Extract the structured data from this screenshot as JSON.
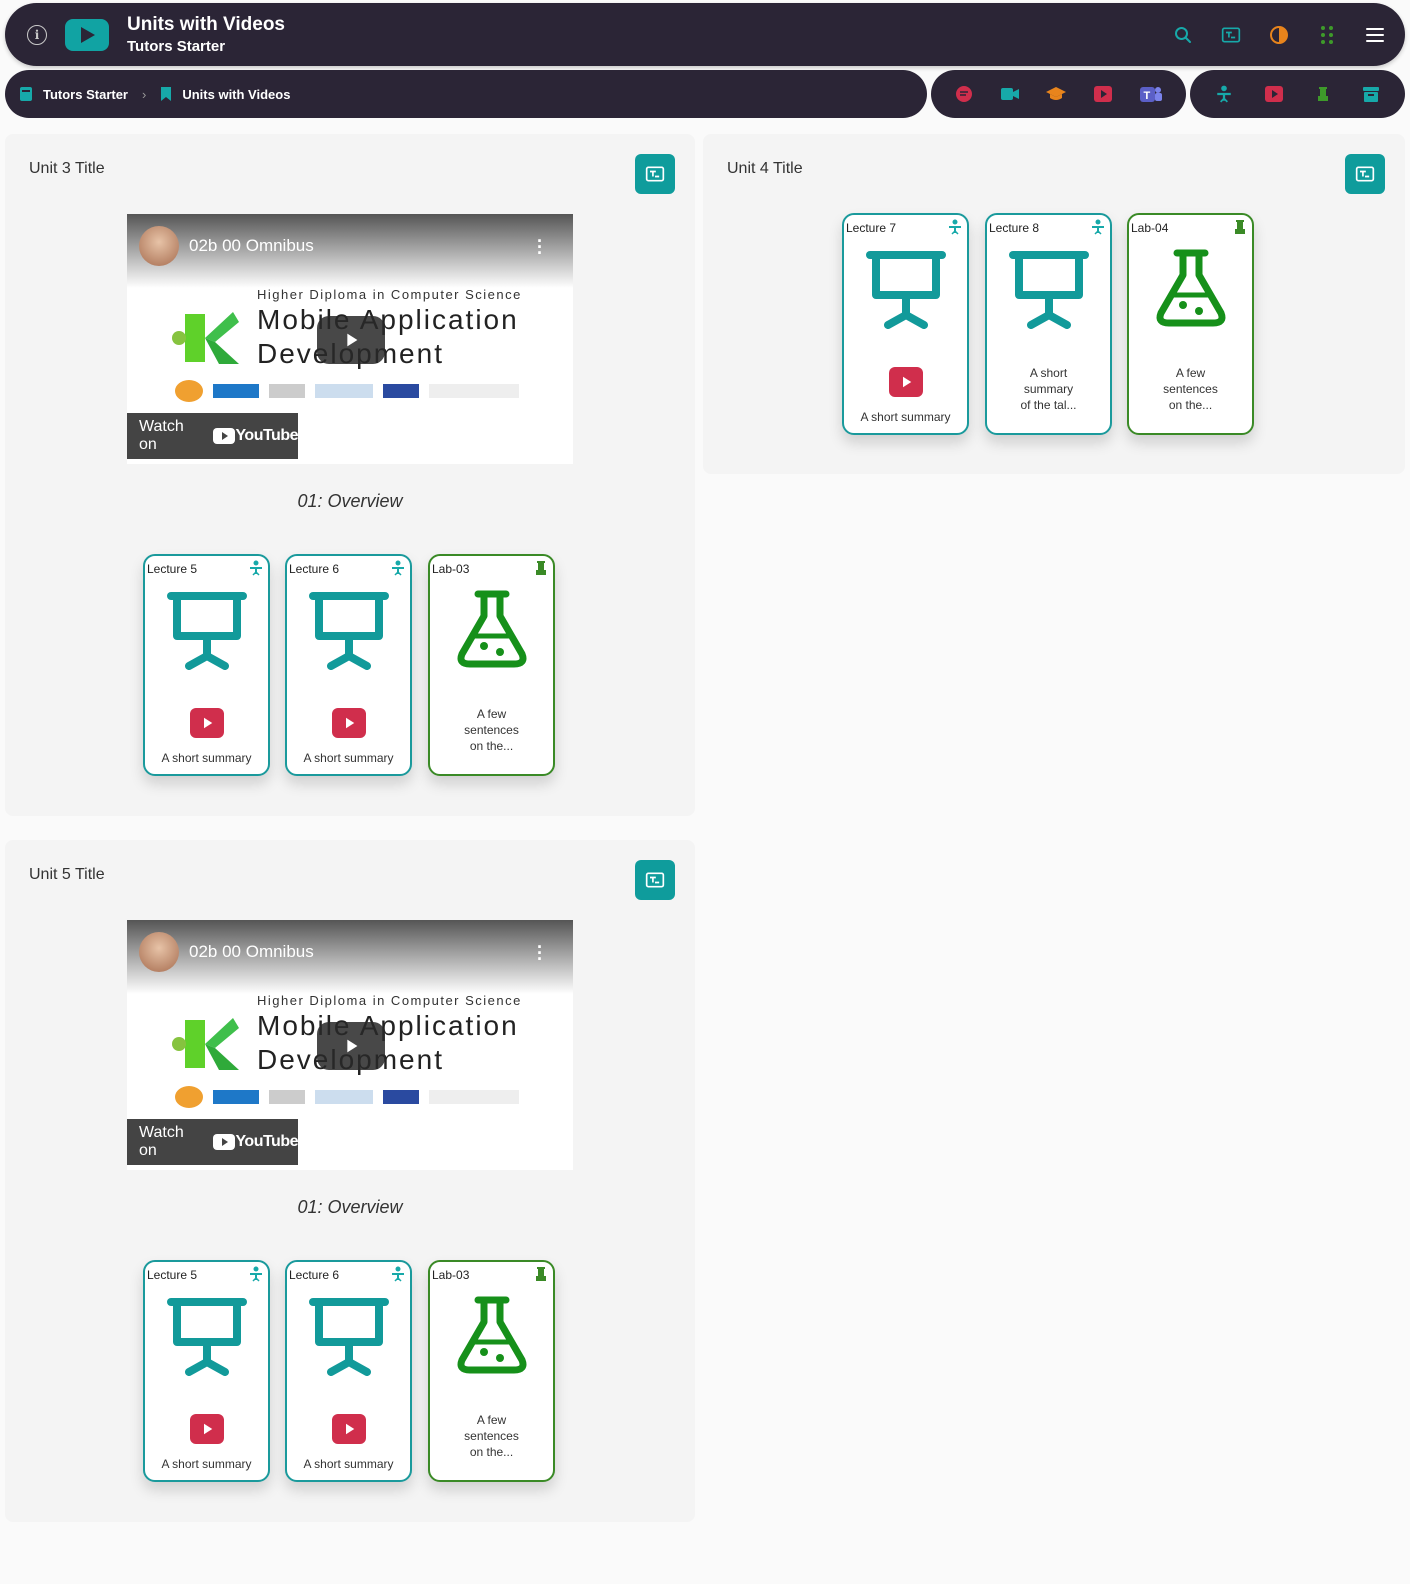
{
  "header": {
    "title": "Units with Videos",
    "subtitle": "Tutors Starter",
    "icons": [
      "info-icon",
      "play-logo-icon",
      "search-icon",
      "tutors-icon",
      "contrast-icon",
      "apps-grid-icon",
      "hamburger-menu-icon"
    ]
  },
  "breadcrumb": {
    "items": [
      {
        "label": "Tutors Starter",
        "icon": "course-book-icon"
      },
      {
        "label": "Units with Videos",
        "icon": "bookmark-icon"
      }
    ]
  },
  "toolbar1": [
    "chat-icon",
    "video-camera-icon",
    "graduation-cap-icon",
    "youtube-icon",
    "teams-icon"
  ],
  "toolbar2": [
    "lecture-icon",
    "youtube-icon",
    "lab-icon",
    "archive-icon"
  ],
  "colors": {
    "bar": "#2b2536",
    "teal": "#0f9c9c",
    "green": "#3a8a26",
    "red": "#d02e4c",
    "orange": "#e8841c"
  },
  "video": {
    "title": "02b 00 Omnibus",
    "subtitle": "Higher Diploma in Computer Science",
    "line1": "Mobile Application",
    "line2": "Development",
    "watch_on": "Watch on",
    "youtube": "YouTube"
  },
  "units": [
    {
      "title": "Unit 3 Title",
      "caption": "01: Overview",
      "cards": [
        {
          "label": "Lecture 5",
          "kind": "lecture",
          "summary": "A short summary",
          "has_video": true
        },
        {
          "label": "Lecture 6",
          "kind": "lecture",
          "summary": "A short summary",
          "has_video": true
        },
        {
          "label": "Lab-03",
          "kind": "lab",
          "summary_lines": [
            "A few",
            "sentences",
            "on the..."
          ]
        }
      ]
    },
    {
      "title": "Unit 4 Title",
      "cards": [
        {
          "label": "Lecture 7",
          "kind": "lecture",
          "summary": "A short summary",
          "has_video": true
        },
        {
          "label": "Lecture 8",
          "kind": "lecture",
          "summary_lines": [
            "A short",
            "summary",
            "of the tal..."
          ]
        },
        {
          "label": "Lab-04",
          "kind": "lab",
          "summary_lines": [
            "A few",
            "sentences",
            "on the..."
          ]
        }
      ]
    },
    {
      "title": "Unit 5 Title",
      "caption": "01: Overview",
      "cards": [
        {
          "label": "Lecture 5",
          "kind": "lecture",
          "summary": "A short summary",
          "has_video": true
        },
        {
          "label": "Lecture 6",
          "kind": "lecture",
          "summary": "A short summary",
          "has_video": true
        },
        {
          "label": "Lab-03",
          "kind": "lab",
          "summary_lines": [
            "A few",
            "sentences",
            "on the..."
          ]
        }
      ]
    }
  ]
}
